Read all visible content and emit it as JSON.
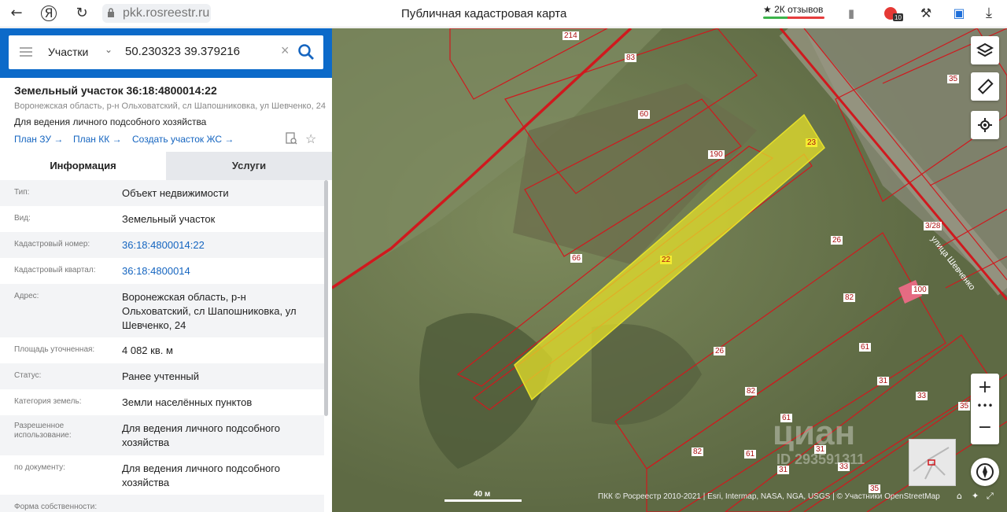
{
  "browser": {
    "url": "pkk.rosreestr.ru",
    "page_title": "Публичная кадастровая карта",
    "reviews": "★ 2К отзывов",
    "yandex_glyph": "Я",
    "badge": "10"
  },
  "search": {
    "type": "Участки",
    "query": "50.230323 39.379216"
  },
  "object": {
    "title": "Земельный участок 36:18:4800014:22",
    "address": "Воронежская область, р-н Ольховатский, сл Шапошниковка, ул Шевченко, 24",
    "purpose": "Для ведения личного подсобного хозяйства",
    "links": [
      "План ЗУ →",
      "План КК →",
      "Создать участок ЖС →"
    ]
  },
  "tabs": {
    "info": "Информация",
    "services": "Услуги"
  },
  "properties": [
    {
      "label": "Тип:",
      "value": "Объект недвижимости"
    },
    {
      "label": "Вид:",
      "value": "Земельный участок"
    },
    {
      "label": "Кадастровый номер:",
      "value": "36:18:4800014:22"
    },
    {
      "label": "Кадастровый квартал:",
      "value": "36:18:4800014"
    },
    {
      "label": "Адрес:",
      "value": "Воронежская область, р-н Ольховатский, сл Шапошниковка, ул Шевченко, 24"
    },
    {
      "label": "Площадь уточненная:",
      "value": "4 082 кв. м"
    },
    {
      "label": "Статус:",
      "value": "Ранее учтенный"
    },
    {
      "label": "Категория земель:",
      "value": "Земли населённых пунктов"
    },
    {
      "label": "Разрешенное использование:",
      "value": "Для ведения личного подсобного хозяйства"
    },
    {
      "label": "по документу:",
      "value": "Для ведения личного подсобного хозяйства"
    },
    {
      "label": "Форма собственности:",
      "value": ""
    }
  ],
  "map": {
    "scale": "40 м",
    "attribution": "ПКК © Росреестр 2010-2021 | Esri, Intermap, NASA, NGA, USGS | © Участники OpenStreetMap",
    "street": "улица Шевченко",
    "watermark": "циан",
    "watermark_id": "ID 293591311",
    "parcel_labels": [
      "214",
      "83",
      "60",
      "190",
      "23",
      "66",
      "22",
      "35",
      "26",
      "82",
      "100",
      "26",
      "82",
      "61",
      "31",
      "33",
      "35",
      "61",
      "82",
      "61",
      "31",
      "31",
      "33",
      "35",
      "3/28"
    ],
    "highlight_color": "#e6e02a",
    "boundary_color": "#d0191e"
  }
}
